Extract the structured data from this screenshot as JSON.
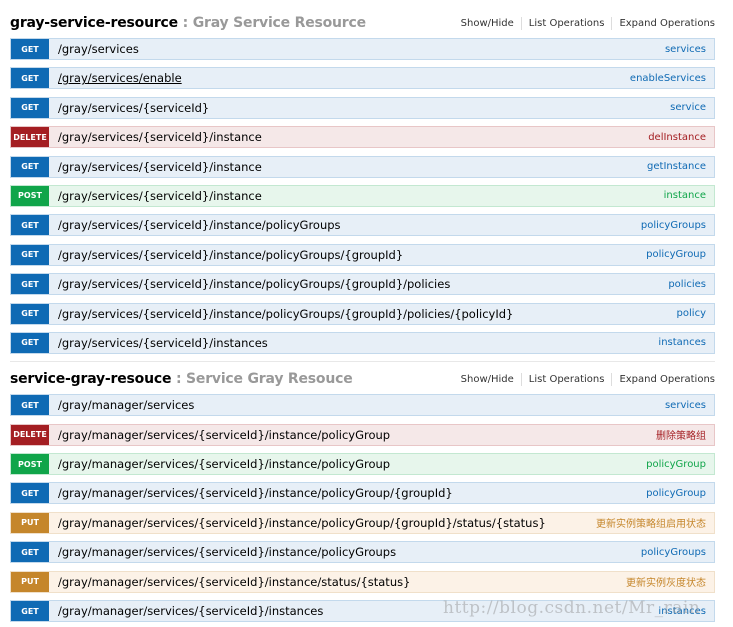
{
  "colors": {
    "get": "#0f6ab4",
    "delete": "#a41e22",
    "post": "#10a54a",
    "put": "#c5862b"
  },
  "resources": [
    {
      "name": "gray-service-resource",
      "description": ": Gray Service Resource",
      "actions": {
        "show_hide": "Show/Hide",
        "list_operations": "List Operations",
        "expand_operations": "Expand Operations"
      },
      "operations": [
        {
          "method": "GET",
          "path": "/gray/services",
          "nickname": "services"
        },
        {
          "method": "GET",
          "path": "/gray/services/enable",
          "nickname": "enableServices"
        },
        {
          "method": "GET",
          "path": "/gray/services/{serviceId}",
          "nickname": "service"
        },
        {
          "method": "DELETE",
          "path": "/gray/services/{serviceId}/instance",
          "nickname": "delInstance"
        },
        {
          "method": "GET",
          "path": "/gray/services/{serviceId}/instance",
          "nickname": "getInstance"
        },
        {
          "method": "POST",
          "path": "/gray/services/{serviceId}/instance",
          "nickname": "instance"
        },
        {
          "method": "GET",
          "path": "/gray/services/{serviceId}/instance/policyGroups",
          "nickname": "policyGroups"
        },
        {
          "method": "GET",
          "path": "/gray/services/{serviceId}/instance/policyGroups/{groupId}",
          "nickname": "policyGroup"
        },
        {
          "method": "GET",
          "path": "/gray/services/{serviceId}/instance/policyGroups/{groupId}/policies",
          "nickname": "policies"
        },
        {
          "method": "GET",
          "path": "/gray/services/{serviceId}/instance/policyGroups/{groupId}/policies/{policyId}",
          "nickname": "policy"
        },
        {
          "method": "GET",
          "path": "/gray/services/{serviceId}/instances",
          "nickname": "instances"
        }
      ]
    },
    {
      "name": "service-gray-resouce",
      "description": ": Service Gray Resouce",
      "actions": {
        "show_hide": "Show/Hide",
        "list_operations": "List Operations",
        "expand_operations": "Expand Operations"
      },
      "operations": [
        {
          "method": "GET",
          "path": "/gray/manager/services",
          "nickname": "services"
        },
        {
          "method": "DELETE",
          "path": "/gray/manager/services/{serviceId}/instance/policyGroup",
          "nickname": "删除策略组"
        },
        {
          "method": "POST",
          "path": "/gray/manager/services/{serviceId}/instance/policyGroup",
          "nickname": "policyGroup"
        },
        {
          "method": "GET",
          "path": "/gray/manager/services/{serviceId}/instance/policyGroup/{groupId}",
          "nickname": "policyGroup"
        },
        {
          "method": "PUT",
          "path": "/gray/manager/services/{serviceId}/instance/policyGroup/{groupId}/status/{status}",
          "nickname": "更新实例策略组启用状态"
        },
        {
          "method": "GET",
          "path": "/gray/manager/services/{serviceId}/instance/policyGroups",
          "nickname": "policyGroups"
        },
        {
          "method": "PUT",
          "path": "/gray/manager/services/{serviceId}/instance/status/{status}",
          "nickname": "更新实例灰度状态"
        },
        {
          "method": "GET",
          "path": "/gray/manager/services/{serviceId}/instances",
          "nickname": "instances"
        }
      ]
    }
  ],
  "watermark": "http://blog.csdn.net/Mr_rain"
}
